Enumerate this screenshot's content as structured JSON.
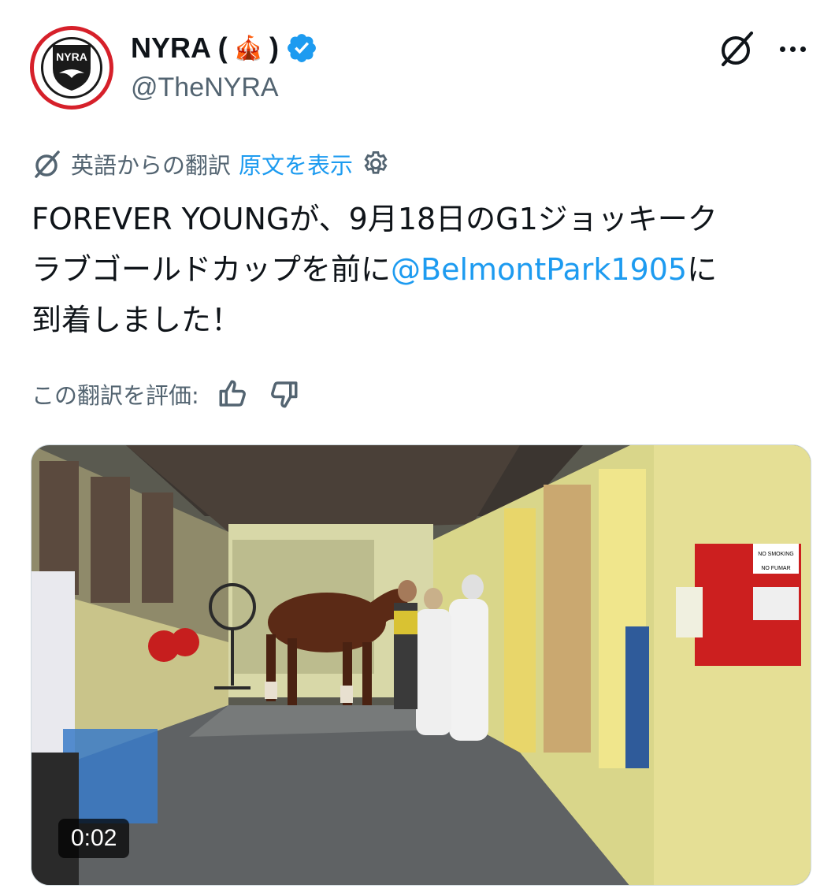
{
  "tweet": {
    "display_name": "NYRA (",
    "display_name_close": ")",
    "name_emoji": "🎪",
    "handle": "@TheNYRA",
    "avatar_text": "NYRA",
    "translation_label": "英語からの翻訳",
    "show_original_label": "原文を表示",
    "text_line1": "FOREVER YOUNGが、9月18日のG1ジョッキーク",
    "text_line2_pre": "ラブゴールドカップを前に",
    "mention": "@BelmontPark1905",
    "text_line2_post": "に",
    "text_line3": "到着しました！",
    "rate_label": "この翻訳を評価:",
    "video_duration": "0:02",
    "sign_no_smoking": "NO SMOKING",
    "sign_no_fumar": "NO FUMAR"
  },
  "icons": [
    "verified-badge-icon",
    "grok-icon",
    "more-icon",
    "translate-icon",
    "gear-icon",
    "thumbs-up-icon",
    "thumbs-down-icon"
  ],
  "colors": {
    "accent": "#1d9bf0",
    "text": "#0f1419",
    "secondary": "#536471",
    "avatar_ring": "#d6202a"
  }
}
